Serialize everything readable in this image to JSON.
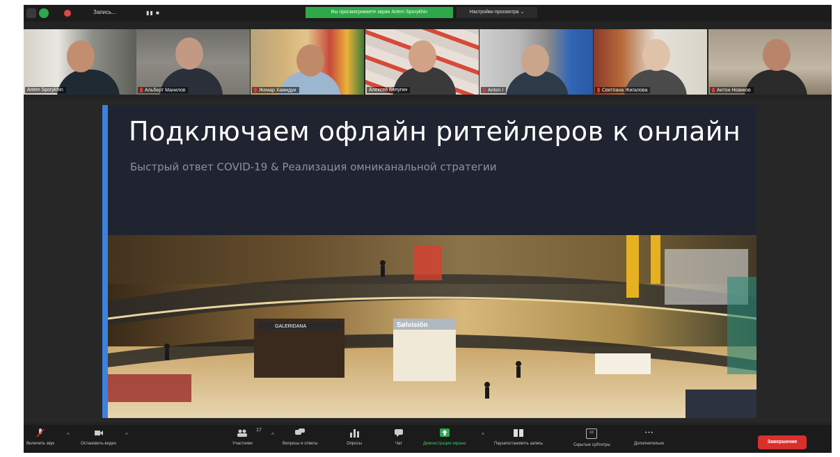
{
  "topbar": {
    "record_label": "Запись...",
    "pause_glyph": "▮▮  ■",
    "banner_text": "Вы просматриваете экран Artem Sporykhin",
    "view_options": "Настройки просмотра ⌄"
  },
  "participants": [
    {
      "name": "Artem Sporykhin",
      "muted": false
    },
    {
      "name": "Альберт Манилов",
      "muted": true
    },
    {
      "name": "Жемар Хамидун",
      "muted": true
    },
    {
      "name": "Алексей Белугин",
      "muted": false
    },
    {
      "name": "Anton I",
      "muted": true
    },
    {
      "name": "Светлана Жигалова",
      "muted": true
    },
    {
      "name": "Антон Новиков",
      "muted": true
    }
  ],
  "slide": {
    "title": "Подключаем офлайн ритейлеров к онлайн",
    "subtitle": "Быстрый ответ COVID-19  & Реализация омниканальной стратегии",
    "store_signs": [
      "GALERIDANA",
      "Sølvisión"
    ]
  },
  "toolbar": {
    "unmute": "Включить звук",
    "stop_video": "Остановить видео",
    "participants": "Участники",
    "participants_count": "17",
    "qa": "Вопросы и ответы",
    "polls": "Опросы",
    "chat": "Чат",
    "share": "Демонстрация экрана",
    "pause_record": "Пауза/остановить запись",
    "captions": "Скрытые субтитры",
    "more": "Дополнительно",
    "end": "Завершение",
    "cc_glyph": "cc",
    "more_glyph": "• • •"
  },
  "colors": {
    "accent": "#3a82e0",
    "share_green": "#2ea84a",
    "end_red": "#d9302b"
  }
}
